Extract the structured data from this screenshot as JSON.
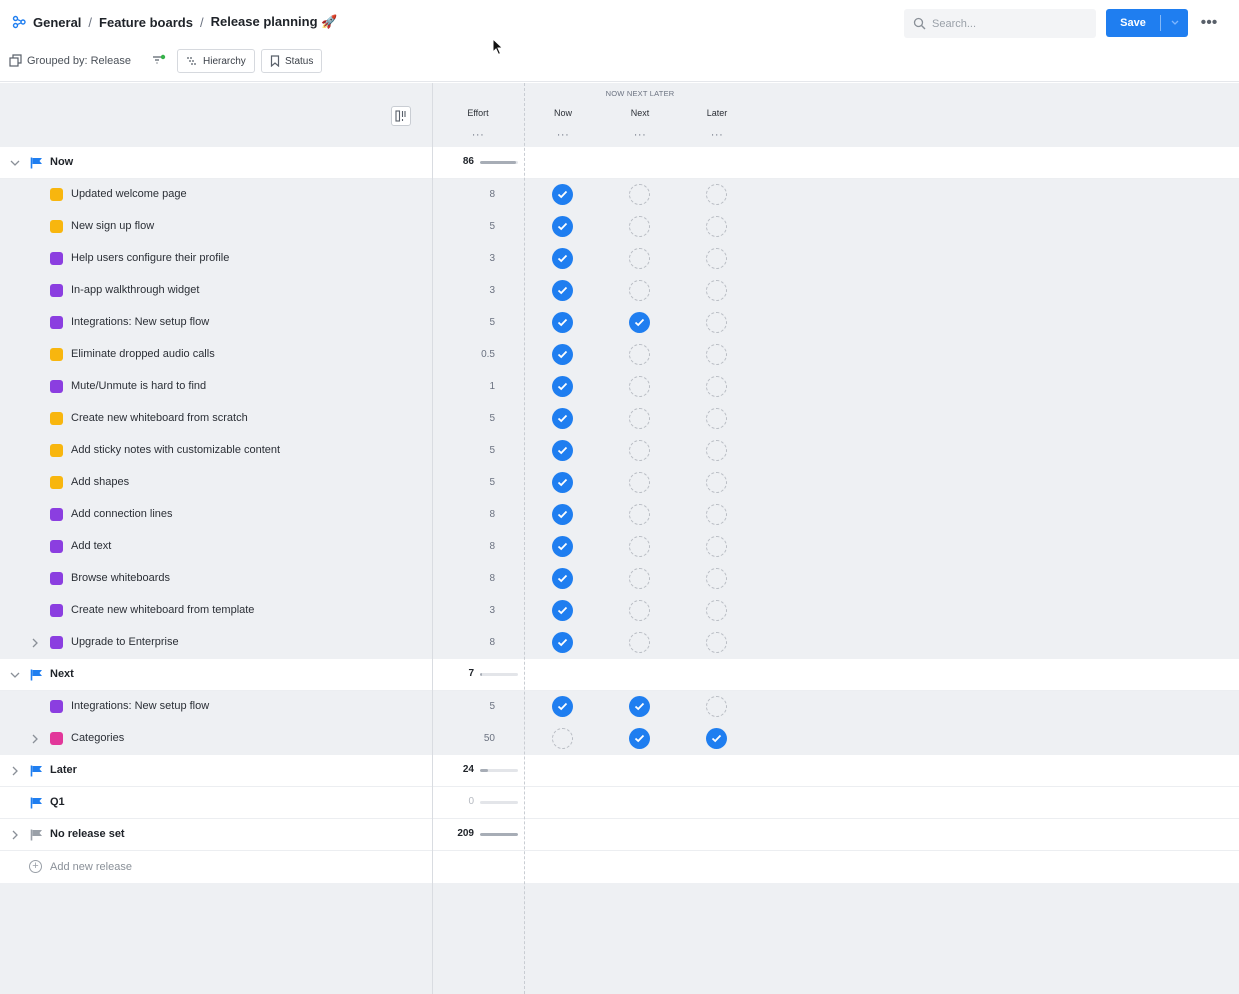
{
  "breadcrumb": [
    "General",
    "Feature boards",
    "Release planning 🚀"
  ],
  "search": {
    "placeholder": "Search..."
  },
  "actions": {
    "save_label": "Save"
  },
  "toolbar": {
    "grouped_by": "Grouped by: Release",
    "hierarchy_label": "Hierarchy",
    "status_label": "Status"
  },
  "columns": {
    "effort": "Effort",
    "group_label": "NOW NEXT LATER",
    "now": "Now",
    "next": "Next",
    "later": "Later",
    "dots": "···"
  },
  "colors": {
    "accent": "#1f7ef0",
    "idea_yellow": "#f8b60e",
    "purple": "#8b3ee0",
    "pink": "#e2379a",
    "flag_blue": "#1f7ef0",
    "flag_gray": "#9aa0a8"
  },
  "groups": [
    {
      "name": "Now",
      "effort": "86",
      "expanded": true,
      "flag": "blue",
      "progress": 0.94,
      "features": [
        {
          "name": "Updated welcome page",
          "effort": "8",
          "color": "yellow",
          "now": true,
          "next": false,
          "later": false
        },
        {
          "name": "New sign up flow",
          "effort": "5",
          "color": "yellow",
          "now": true,
          "next": false,
          "later": false
        },
        {
          "name": "Help users configure their profile",
          "effort": "3",
          "color": "purple",
          "now": true,
          "next": false,
          "later": false
        },
        {
          "name": "In-app walkthrough widget",
          "effort": "3",
          "color": "purple",
          "now": true,
          "next": false,
          "later": false
        },
        {
          "name": "Integrations: New setup flow",
          "effort": "5",
          "color": "purple",
          "now": true,
          "next": true,
          "later": false
        },
        {
          "name": "Eliminate dropped audio calls",
          "effort": "0.5",
          "color": "yellow",
          "now": true,
          "next": false,
          "later": false
        },
        {
          "name": "Mute/Unmute is hard to find",
          "effort": "1",
          "color": "purple",
          "now": true,
          "next": false,
          "later": false
        },
        {
          "name": "Create new whiteboard from scratch",
          "effort": "5",
          "color": "yellow",
          "now": true,
          "next": false,
          "later": false
        },
        {
          "name": "Add sticky notes with customizable content",
          "effort": "5",
          "color": "yellow",
          "now": true,
          "next": false,
          "later": false
        },
        {
          "name": "Add shapes",
          "effort": "5",
          "color": "yellow",
          "now": true,
          "next": false,
          "later": false
        },
        {
          "name": "Add connection lines",
          "effort": "8",
          "color": "purple",
          "now": true,
          "next": false,
          "later": false
        },
        {
          "name": "Add text",
          "effort": "8",
          "color": "purple",
          "now": true,
          "next": false,
          "later": false
        },
        {
          "name": "Browse whiteboards",
          "effort": "8",
          "color": "purple",
          "now": true,
          "next": false,
          "later": false
        },
        {
          "name": "Create new whiteboard from template",
          "effort": "3",
          "color": "purple",
          "now": true,
          "next": false,
          "later": false
        },
        {
          "name": "Upgrade to Enterprise",
          "effort": "8",
          "color": "purple",
          "now": true,
          "next": false,
          "later": false,
          "expandable": true
        }
      ]
    },
    {
      "name": "Next",
      "effort": "7",
      "expanded": true,
      "flag": "blue",
      "progress": 0.04,
      "features": [
        {
          "name": "Integrations: New setup flow",
          "effort": "5",
          "color": "purple",
          "now": true,
          "next": true,
          "later": false
        },
        {
          "name": "Categories",
          "effort": "50",
          "color": "pink",
          "now": false,
          "next": true,
          "later": true,
          "expandable": true
        }
      ]
    },
    {
      "name": "Later",
      "effort": "24",
      "expanded": false,
      "flag": "blue",
      "progress": 0.2,
      "features": []
    },
    {
      "name": "Q1",
      "effort": "0",
      "expanded": null,
      "flag": "blue",
      "progress": 0,
      "features": [],
      "muted": true
    },
    {
      "name": "No release set",
      "effort": "209",
      "expanded": false,
      "flag": "gray",
      "progress": 1.0,
      "features": []
    }
  ],
  "add_release_label": "Add new release"
}
